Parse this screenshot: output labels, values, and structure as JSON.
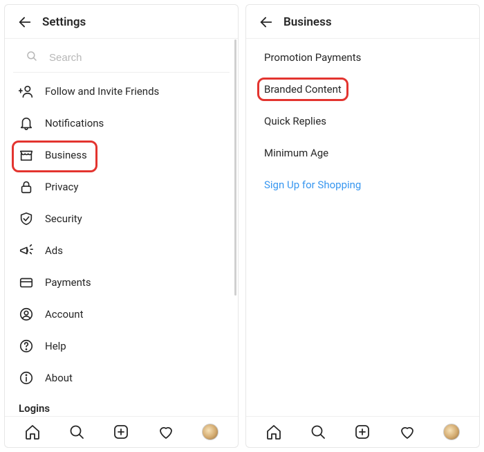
{
  "left": {
    "title": "Settings",
    "search_placeholder": "Search",
    "items": [
      {
        "label": "Follow and Invite Friends"
      },
      {
        "label": "Notifications"
      },
      {
        "label": "Business"
      },
      {
        "label": "Privacy"
      },
      {
        "label": "Security"
      },
      {
        "label": "Ads"
      },
      {
        "label": "Payments"
      },
      {
        "label": "Account"
      },
      {
        "label": "Help"
      },
      {
        "label": "About"
      }
    ],
    "section": "Logins"
  },
  "right": {
    "title": "Business",
    "items": [
      {
        "label": "Promotion Payments"
      },
      {
        "label": "Branded Content"
      },
      {
        "label": "Quick Replies"
      },
      {
        "label": "Minimum Age"
      },
      {
        "label": "Sign Up for Shopping"
      }
    ]
  }
}
